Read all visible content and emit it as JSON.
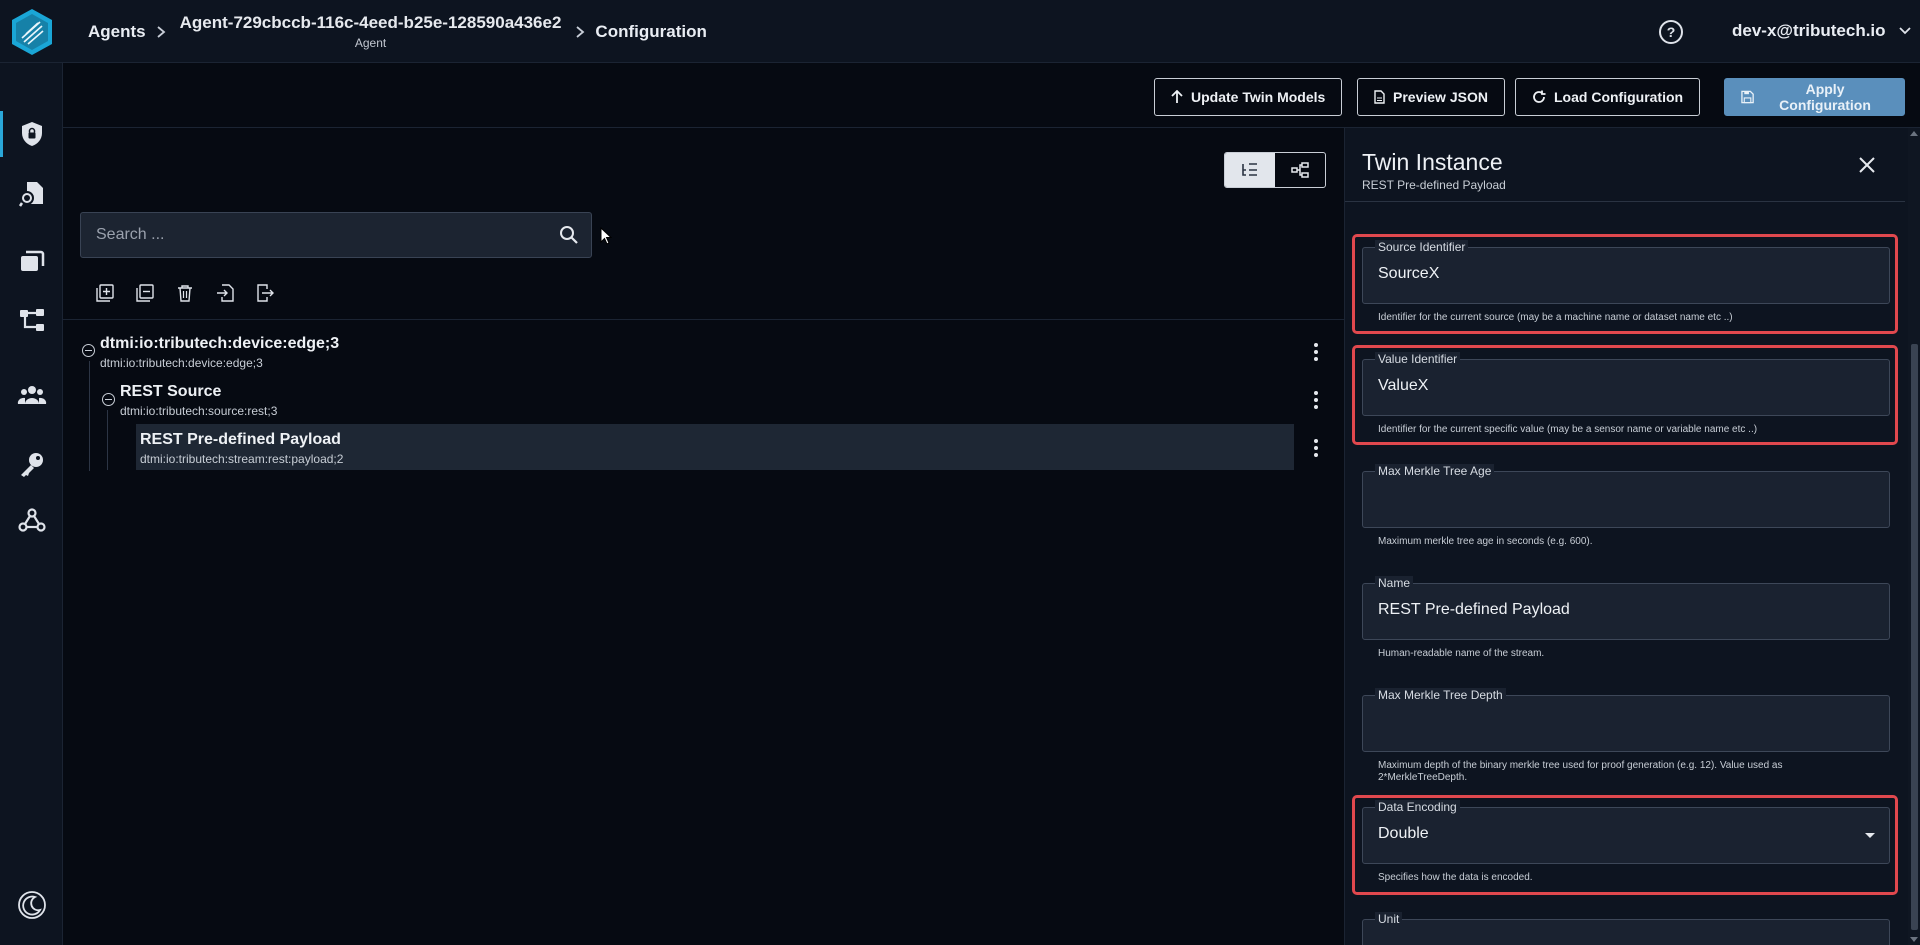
{
  "breadcrumb": {
    "root": "Agents",
    "agent_name": "Agent-729cbccb-116c-4eed-b25e-128590a436e2",
    "agent_type": "Agent",
    "current": "Configuration"
  },
  "header": {
    "help_glyph": "?",
    "user": "dev-x@tributech.io"
  },
  "toolbar": {
    "update_twin_models": "Update Twin Models",
    "preview_json": "Preview JSON",
    "load_configuration": "Load Configuration",
    "apply_configuration": "Apply Configuration"
  },
  "search": {
    "placeholder": "Search ..."
  },
  "tree": {
    "nodes": [
      {
        "title": "dtmi:io:tributech:device:edge;3",
        "subtitle": "dtmi:io:tributech:device:edge;3"
      },
      {
        "title": "REST Source",
        "subtitle": "dtmi:io:tributech:source:rest;3"
      },
      {
        "title": "REST Pre-defined Payload",
        "subtitle": "dtmi:io:tributech:stream:rest:payload;2"
      }
    ]
  },
  "panel": {
    "title": "Twin Instance",
    "subtitle": "REST Pre-defined Payload",
    "fields": [
      {
        "label": "Source Identifier",
        "value": "SourceX",
        "help": "Identifier for the current source (may be a machine name or dataset name etc ..)"
      },
      {
        "label": "Value Identifier",
        "value": "ValueX",
        "help": "Identifier for the current specific value (may be a sensor name or variable name etc ..)"
      },
      {
        "label": "Max Merkle Tree Age",
        "value": "",
        "help": "Maximum merkle tree age in seconds (e.g. 600)."
      },
      {
        "label": "Name",
        "value": "REST Pre-defined Payload",
        "help": "Human-readable name of the stream."
      },
      {
        "label": "Max Merkle Tree Depth",
        "value": "",
        "help": "Maximum depth of the binary merkle tree used for proof generation (e.g. 12). Value used as 2*MerkleTreeDepth."
      },
      {
        "label": "Data Encoding",
        "value": "Double",
        "help": "Specifies how the data is encoded."
      },
      {
        "label": "Unit",
        "value": "",
        "help": ""
      }
    ]
  },
  "colors": {
    "accent": "#2aa7d8",
    "primary_button": "#5a8fbc",
    "highlight": "#e0484e"
  }
}
